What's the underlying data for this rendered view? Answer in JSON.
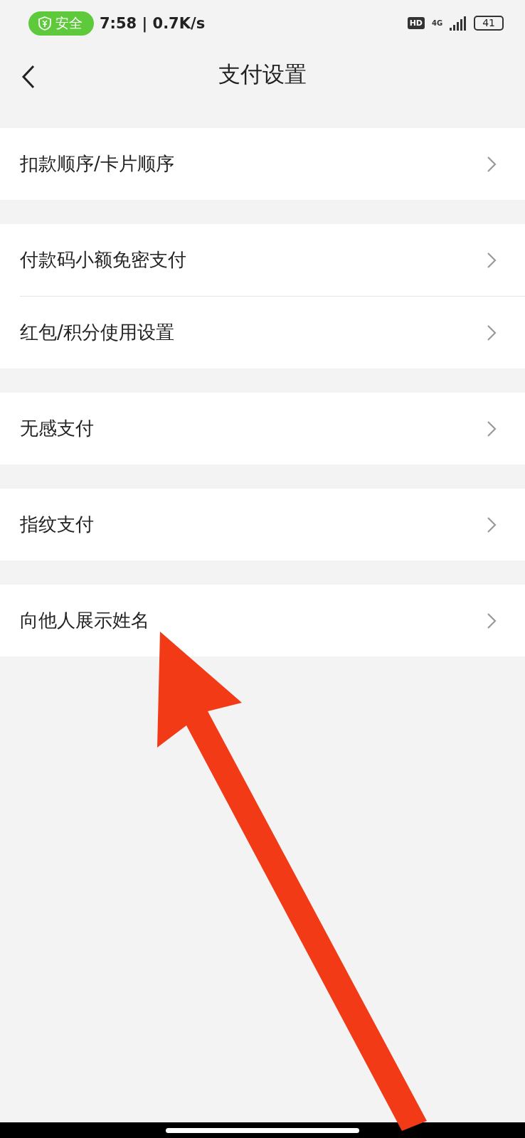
{
  "status_bar": {
    "badge": "安全",
    "time": "7:58 | 0.7K/s",
    "hd": "HD",
    "network": "4G",
    "battery": "41"
  },
  "header": {
    "title": "支付设置"
  },
  "groups": [
    {
      "items": [
        {
          "label": "扣款顺序/卡片顺序"
        }
      ]
    },
    {
      "items": [
        {
          "label": "付款码小额免密支付"
        },
        {
          "label": "红包/积分使用设置"
        }
      ]
    },
    {
      "items": [
        {
          "label": "无感支付"
        }
      ]
    },
    {
      "items": [
        {
          "label": "指纹支付"
        }
      ]
    },
    {
      "items": [
        {
          "label": "向他人展示姓名"
        }
      ]
    }
  ]
}
